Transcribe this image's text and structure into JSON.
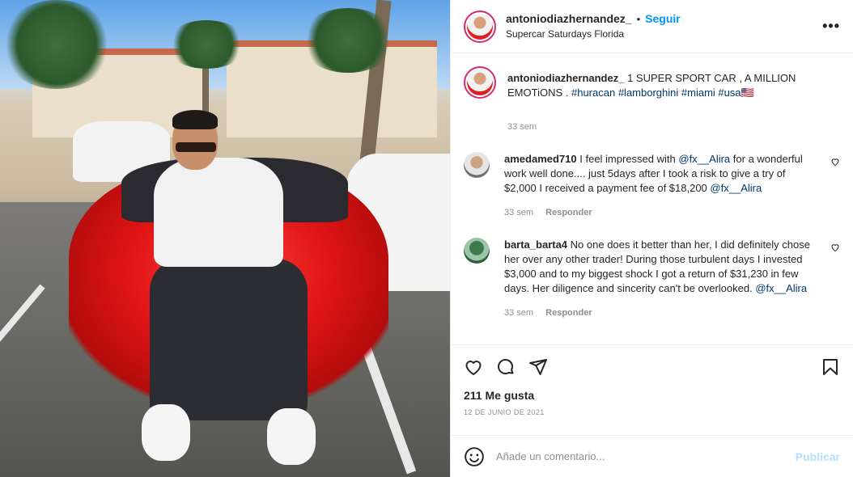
{
  "post": {
    "username": "antoniodiazhernandez_",
    "separator": "•",
    "follow_label": "Seguir",
    "location": "Supercar Saturdays Florida",
    "more_label": "•••"
  },
  "caption": {
    "username": "antoniodiazhernandez_",
    "text": "1 SUPER SPORT CAR , A MILLION EMOTiONS .",
    "tags": [
      "#huracan",
      "#lamborghini",
      "#miami",
      "#usa🇺🇸"
    ],
    "time": "33 sem"
  },
  "comments": [
    {
      "username": "amedamed710",
      "text_1": "I feel impressed with",
      "mention_1": "@fx__Alira",
      "text_2": "for a wonderful work well done.... just 5days after I took a risk to give a try of $2,000 I received a payment fee of $18,200",
      "mention_2": "@fx__Alira",
      "time": "33 sem",
      "reply_label": "Responder"
    },
    {
      "username": "barta_barta4",
      "text_1": "No one does it better than her, I did definitely chose her over any other trader! During those turbulent days I invested $3,000 and to my biggest shock I got a return of $31,230 in few days. Her diligence and sincerity can't be overlooked.",
      "mention_1": "@fx__Alira",
      "time": "33 sem",
      "reply_label": "Responder"
    }
  ],
  "actions": {
    "likes": "211 Me gusta",
    "date": "12 DE JUNIO DE 2021"
  },
  "add_comment": {
    "placeholder": "Añade un comentario...",
    "publish_label": "Publicar"
  },
  "colors": {
    "accent": "#0095f6",
    "publish_disabled": "#b2dffc",
    "link": "#00376b",
    "muted": "#8e8e8e"
  }
}
